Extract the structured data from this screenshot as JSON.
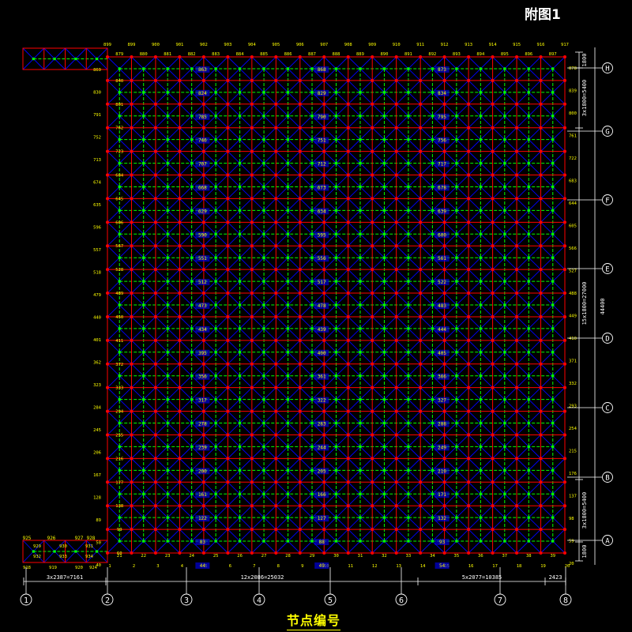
{
  "figure_title": "附图1",
  "caption": "节点编号",
  "colors": {
    "background": "#000000",
    "top_chord": "#ff0000",
    "bottom_chord": "#00ff00",
    "web_member": "#0000ff",
    "node": "#ff0000",
    "label": "#ffff00",
    "dimension": "#ffffff"
  },
  "axis_columns": [
    "1",
    "2",
    "3",
    "4",
    "5",
    "6",
    "7",
    "8"
  ],
  "axis_rows": [
    "A",
    "B",
    "C",
    "D",
    "E",
    "F",
    "G",
    "H"
  ],
  "dim_bottom": [
    "3x2387=7161",
    "12x2086=25032",
    "5x2077=10385",
    "2423"
  ],
  "dim_right": [
    "1800",
    "3x1800=5400",
    "15x1800=27000",
    "44400",
    "3x1800=5400",
    "1800"
  ],
  "top_number_row": [
    "899",
    "899",
    "900",
    "901",
    "902",
    "903",
    "904",
    "905",
    "906",
    "907",
    "908",
    "909",
    "910",
    "911",
    "912",
    "913",
    "914",
    "915",
    "916",
    "917"
  ],
  "second_number_row": [
    "879",
    "880",
    "881",
    "882",
    "883",
    "884",
    "885",
    "886",
    "887",
    "888",
    "889",
    "890",
    "891",
    "892",
    "893",
    "894",
    "895",
    "896",
    "897"
  ],
  "bottom_number_row": [
    "21",
    "22",
    "23",
    "24",
    "25",
    "26",
    "27",
    "28",
    "29",
    "30",
    "31",
    "32",
    "33",
    "34",
    "35",
    "36",
    "37",
    "38",
    "39"
  ],
  "axis_number_row": [
    "1",
    "2",
    "3",
    "4",
    "5",
    "6",
    "7",
    "8",
    "9",
    "10",
    "11",
    "12",
    "13",
    "14",
    "15",
    "16",
    "17",
    "18",
    "19",
    "20"
  ],
  "left_node_numbers": [
    "869",
    "830",
    "791",
    "752",
    "713",
    "674",
    "635",
    "596",
    "557",
    "518",
    "479",
    "440",
    "401",
    "362",
    "323",
    "284",
    "245",
    "206",
    "167",
    "128",
    "89",
    "50",
    "40"
  ],
  "inner_left_numbers": [
    "840",
    "801",
    "762",
    "723",
    "684",
    "645",
    "606",
    "567",
    "528",
    "489",
    "450",
    "411",
    "372",
    "333",
    "294",
    "255",
    "216",
    "177",
    "138",
    "99",
    "60"
  ],
  "right_node_numbers": [
    "878",
    "839",
    "800",
    "761",
    "722",
    "683",
    "644",
    "605",
    "566",
    "527",
    "488",
    "449",
    "410",
    "371",
    "332",
    "293",
    "254",
    "215",
    "176",
    "137",
    "98",
    "59",
    "20"
  ],
  "col_a_numbers": [
    "863",
    "824",
    "785",
    "746",
    "707",
    "668",
    "629",
    "590",
    "551",
    "512",
    "473",
    "434",
    "395",
    "356",
    "317",
    "278",
    "239",
    "200",
    "161",
    "122",
    "83",
    "44"
  ],
  "col_b_numbers": [
    "868",
    "829",
    "790",
    "751",
    "712",
    "673",
    "634",
    "595",
    "556",
    "517",
    "478",
    "439",
    "400",
    "361",
    "322",
    "283",
    "244",
    "205",
    "166",
    "127",
    "88",
    "49"
  ],
  "col_c_numbers": [
    "873",
    "834",
    "795",
    "756",
    "717",
    "678",
    "639",
    "600",
    "561",
    "522",
    "483",
    "444",
    "405",
    "366",
    "327",
    "288",
    "249",
    "210",
    "171",
    "132",
    "93",
    "54"
  ],
  "left_ext_top": [
    "",
    "",
    ""
  ],
  "left_ext_bottom_top": [
    "925",
    "926",
    "927",
    "928"
  ],
  "left_ext_bottom_mid": [
    "929",
    "930",
    "931"
  ],
  "left_ext_bottom_low": [
    "932",
    "933",
    "934"
  ],
  "left_ext_bottom_base": [
    "918",
    "919",
    "920",
    "924"
  ]
}
